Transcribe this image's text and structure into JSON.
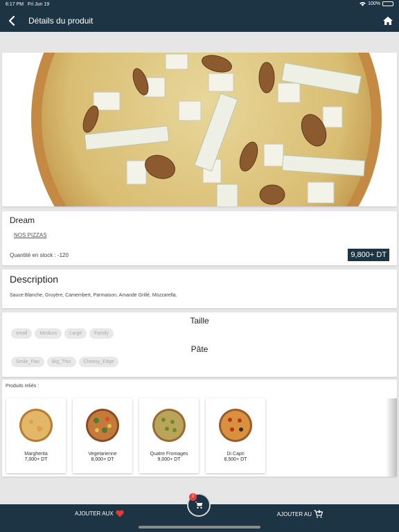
{
  "status": {
    "time": "6:17 PM",
    "date": "Fri Jun 19",
    "battery": "100%"
  },
  "nav": {
    "title": "Détails du produit",
    "back_icon": "chevron-left-icon",
    "home_icon": "home-icon"
  },
  "product": {
    "name": "Dream",
    "category": "NOS PIZZAS",
    "stock": "Quantité en stock : -120",
    "price": "9,800+ DT"
  },
  "description": {
    "heading": "Description",
    "text": "Sauce Blanche, Gruyère, Camembert, Parmaison, Amande Grillé, Mozzarella."
  },
  "options": {
    "size_heading": "Taille",
    "sizes": [
      "small",
      "Medium",
      "Large",
      "Family"
    ],
    "crust_heading": "Pâte",
    "crusts": [
      "Smile_Pan",
      "Big_Thin",
      "Cheesy_Edge"
    ]
  },
  "related": {
    "label": "Produits reliés :",
    "items": [
      {
        "name": "Margherita",
        "price": "7,000+ DT"
      },
      {
        "name": "Vegetarienne",
        "price": "8,000+ DT"
      },
      {
        "name": "Quatre Fromages",
        "price": "9,000+ DT"
      },
      {
        "name": "Di Capri",
        "price": "8,500+ DT"
      }
    ]
  },
  "bottom": {
    "favorites_label": "AJOUTER AUX",
    "cart_label": "AJOUTER AU",
    "cart_count": "0",
    "heart_icon": "heart-icon",
    "cart_icon": "cart-add-icon"
  },
  "colors": {
    "primary": "#1d3444",
    "badge": "#e04040",
    "heart": "#e53935"
  }
}
